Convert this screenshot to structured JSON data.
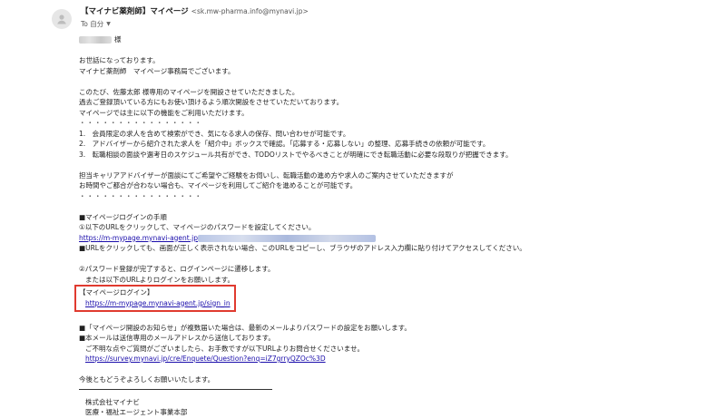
{
  "email": {
    "sender_name": "【マイナビ薬剤師】マイページ",
    "sender_email": "<sk.mw-pharma.info@mynavi.jp>",
    "to_label": "To 自分"
  },
  "greeting": {
    "name_suffix": "様",
    "line1": "お世話になっております。",
    "line2": "マイナビ薬剤師　マイページ事務局でございます。"
  },
  "intro": {
    "line1": "このたび、佐藤太郎 様専用のマイページを開設させていただきました。",
    "line2": "過去ご登録頂いている方にもお使い頂けるよう順次開設をさせていただいております。",
    "line3": "マイページでは主に以下の機能をご利用いただけます。"
  },
  "dots": "・・・・・・・・・・・・・・・・",
  "features": [
    "1.　会員限定の求人を含めて検索ができ、気になる求人の保存、問い合わせが可能です。",
    "2.　アドバイザーから紹介された求人を「紹介中」ボックスで確認。「応募する・応募しない」の整理、応募手続きの依頼が可能です。",
    "3.　転職相談の面談や選考日のスケジュール共有ができ、TODOリストでやるべきことが明確にでき転職活動に必要な段取りが把握できます。"
  ],
  "advisor": {
    "line1": "担当キャリアアドバイザーが面談にてご希望やご経験をお伺いし、転職活動の進め方や求人のご案内させていただきますが",
    "line2": "お時間やご都合が合わない場合も、マイページを利用してご紹介を進めることが可能です。"
  },
  "login": {
    "heading": "■マイページログインの手順",
    "step1": "①以下のURLをクリックして、マイページのパスワードを設定してください。",
    "url_prefix": "https://m-mypage.mynavi-agent.jp",
    "note": "■URLをクリックしても、画面が正しく表示されない場合、このURLをコピーし、ブラウザのアドレス入力欄に貼り付けてアクセスしてください。",
    "step2": "②パスワード登録が完了すると、ログインページに遷移します。",
    "step2b": "または以下のURLよりログインをお願いします。",
    "box_label": "【マイページログイン】",
    "box_url": "https://m-mypage.mynavi-agent.jp/sign_in"
  },
  "notes": {
    "line1": "■「マイページ開設のお知らせ」が複数届いた場合は、最新のメールよりパスワードの設定をお願いします。",
    "line2": "■本メールは送信専用のメールアドレスから送信しております。",
    "line3": "ご不明な点やご質問がございましたら、お手数ですが以下URLよりお問合せくださいませ。",
    "inquiry_url": "https://survey.mynavi.jp/cre/Enquete/Question?enq=iZ7grryQZOc%3D"
  },
  "closing": "今後ともどうぞよろしくお願いいたします。",
  "signature": {
    "company": "株式会社マイナビ",
    "department": "医療・福祉エージェント事業本部"
  },
  "icons": [
    "avatar-person-icon",
    "chevron-down-icon"
  ]
}
